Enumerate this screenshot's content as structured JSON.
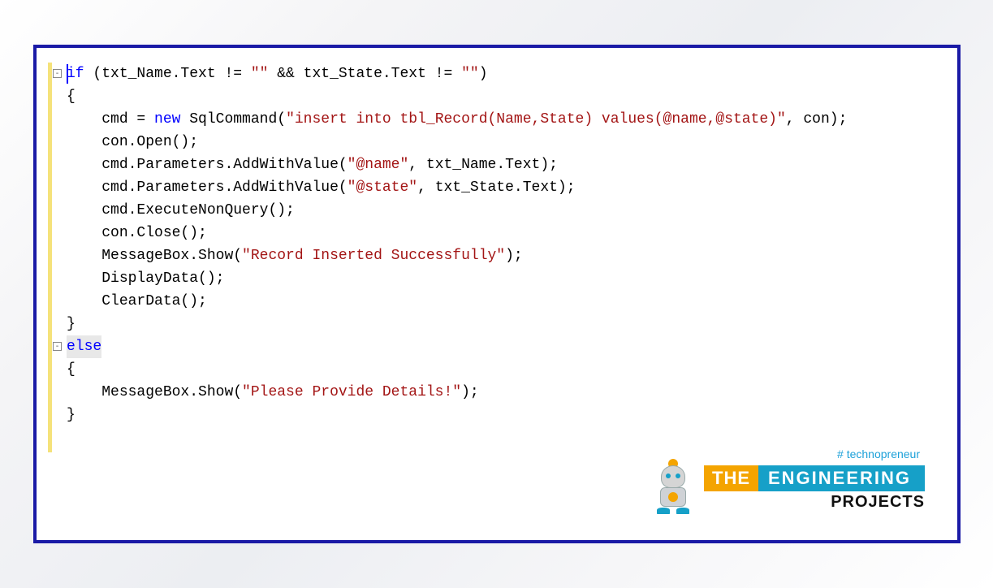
{
  "code": {
    "lines": [
      {
        "indent": 0,
        "tokens": [
          {
            "t": "if",
            "c": "kw"
          },
          {
            "t": " (txt_Name.Text != "
          },
          {
            "t": "\"\"",
            "c": "str"
          },
          {
            "t": " && txt_State.Text != "
          },
          {
            "t": "\"\"",
            "c": "str"
          },
          {
            "t": ")"
          }
        ],
        "highlight": true
      },
      {
        "indent": 0,
        "tokens": [
          {
            "t": "{"
          }
        ]
      },
      {
        "indent": 1,
        "tokens": [
          {
            "t": "cmd = "
          },
          {
            "t": "new",
            "c": "kw"
          },
          {
            "t": " SqlCommand("
          },
          {
            "t": "\"insert into tbl_Record(Name,State) values(@name,@state)\"",
            "c": "str"
          },
          {
            "t": ", con);"
          }
        ]
      },
      {
        "indent": 1,
        "tokens": [
          {
            "t": "con.Open();"
          }
        ]
      },
      {
        "indent": 1,
        "tokens": [
          {
            "t": "cmd.Parameters.AddWithValue("
          },
          {
            "t": "\"@name\"",
            "c": "str"
          },
          {
            "t": ", txt_Name.Text);"
          }
        ]
      },
      {
        "indent": 1,
        "tokens": [
          {
            "t": "cmd.Parameters.AddWithValue("
          },
          {
            "t": "\"@state\"",
            "c": "str"
          },
          {
            "t": ", txt_State.Text);"
          }
        ]
      },
      {
        "indent": 1,
        "tokens": [
          {
            "t": "cmd.ExecuteNonQuery();"
          }
        ]
      },
      {
        "indent": 1,
        "tokens": [
          {
            "t": "con.Close();"
          }
        ]
      },
      {
        "indent": 1,
        "tokens": [
          {
            "t": "MessageBox.Show("
          },
          {
            "t": "\"Record Inserted Successfully\"",
            "c": "str"
          },
          {
            "t": ");"
          }
        ]
      },
      {
        "indent": 1,
        "tokens": [
          {
            "t": "DisplayData();"
          }
        ]
      },
      {
        "indent": 1,
        "tokens": [
          {
            "t": "ClearData();"
          }
        ]
      },
      {
        "indent": 0,
        "tokens": [
          {
            "t": "}"
          }
        ]
      },
      {
        "indent": 0,
        "tokens": [
          {
            "t": "else",
            "c": "kw",
            "hlbox": true
          }
        ]
      },
      {
        "indent": 0,
        "tokens": [
          {
            "t": "{"
          }
        ]
      },
      {
        "indent": 1,
        "tokens": [
          {
            "t": "MessageBox.Show("
          },
          {
            "t": "\"Please Provide Details!\"",
            "c": "str"
          },
          {
            "t": ");"
          }
        ]
      },
      {
        "indent": 0,
        "tokens": [
          {
            "t": "}"
          }
        ]
      }
    ],
    "folds": [
      0,
      12
    ]
  },
  "footer": {
    "hashtag": "# technopreneur",
    "the": "THE",
    "eng": "ENGINEERING",
    "projects": "PROJECTS"
  }
}
